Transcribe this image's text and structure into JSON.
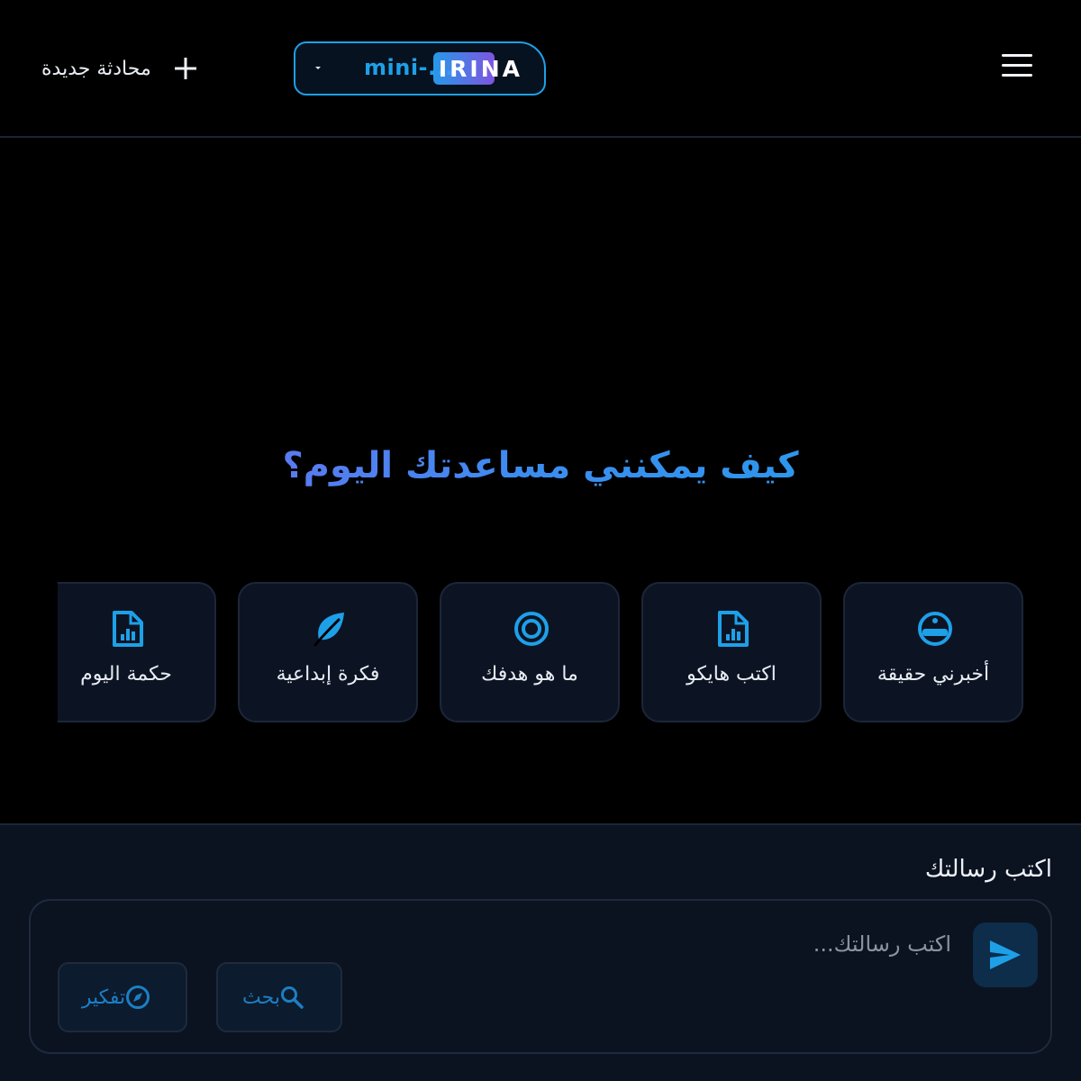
{
  "header": {
    "new_chat_label": "محادثة جديدة",
    "model_name": "mini-...",
    "brand": "IRINA"
  },
  "main": {
    "hero_title": "كيف يمكنني مساعدتك اليوم؟",
    "suggestions": [
      {
        "label": "أخبرني حقيقة",
        "icon": "emoji-icon"
      },
      {
        "label": "اكتب هايكو",
        "icon": "document-chart-icon"
      },
      {
        "label": "ما هو هدفك",
        "icon": "target-icon"
      },
      {
        "label": "فكرة إبداعية",
        "icon": "leaf-icon"
      },
      {
        "label": "حكمة اليوم",
        "icon": "document-chart-icon"
      }
    ]
  },
  "composer": {
    "title": "اكتب رسالتك",
    "placeholder": "اكتب رسالتك...",
    "value": "",
    "tools": [
      {
        "label": "بحث",
        "icon": "search-icon"
      },
      {
        "label": "تفكير",
        "icon": "compass-icon"
      }
    ]
  },
  "colors": {
    "accent": "#1ea0e8",
    "accent_purple": "#7c66f0",
    "card_bg": "#0c1424",
    "composer_bg": "#0b1220"
  }
}
